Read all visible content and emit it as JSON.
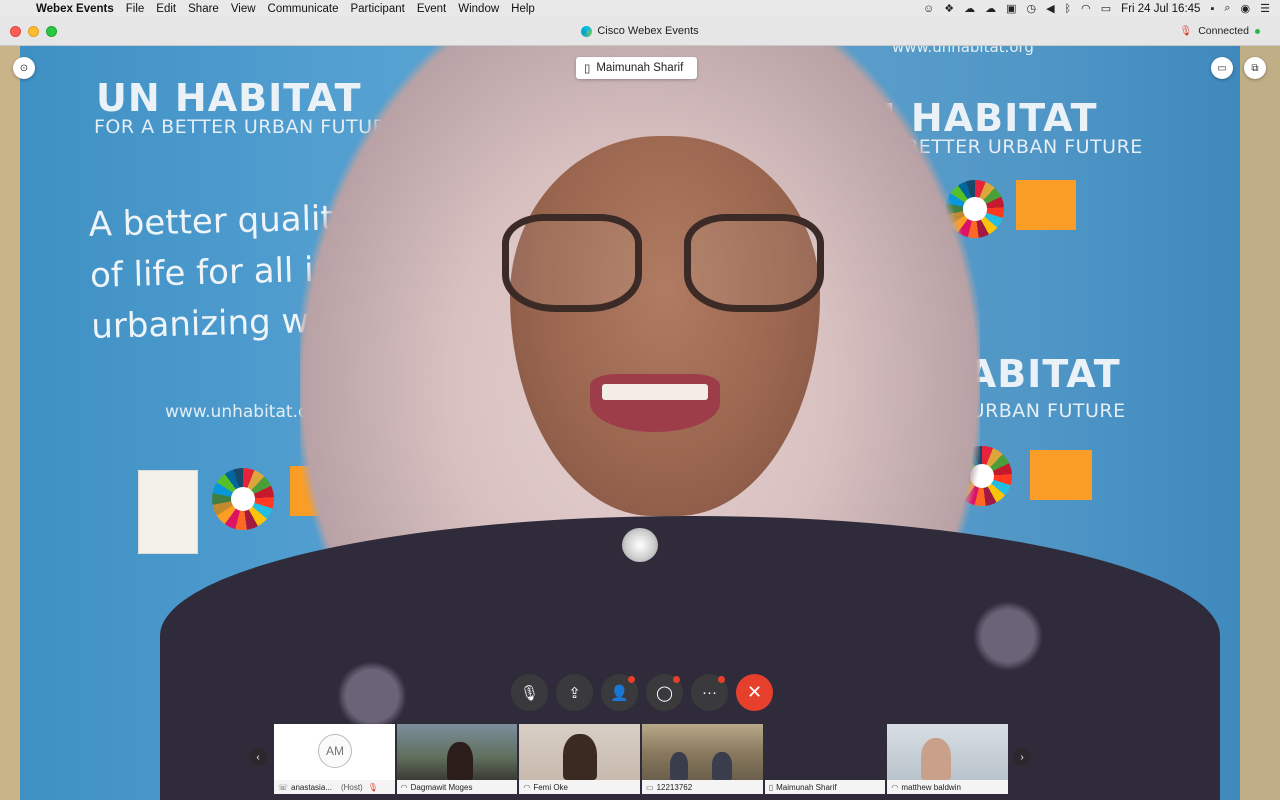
{
  "menubar": {
    "app_name": "Webex Events",
    "items": [
      "File",
      "Edit",
      "Share",
      "View",
      "Communicate",
      "Participant",
      "Event",
      "Window",
      "Help"
    ],
    "clock": "Fri 24 Jul  16:45"
  },
  "window": {
    "title": "Cisco Webex Events",
    "connection_status": "Connected"
  },
  "active_speaker": {
    "name": "Maimunah Sharif"
  },
  "background": {
    "logo_left": "UN HABITAT",
    "logo_sub": "FOR A BETTER URBAN FUTURE",
    "slogan_lines": [
      "A better quality",
      "of life for all in an",
      "urbanizing world"
    ],
    "url": "www.unhabitat.org",
    "url_top": "www.unhabitat.org",
    "logo_right_top": "UN HABITAT",
    "logo_right_sub": "FOR A BETTER URBAN FUTURE",
    "logo_right_mid": "HABITAT",
    "logo_right_mid_sub": "BETTER URBAN FUTURE"
  },
  "controls": [
    {
      "name": "mute-button",
      "icon": "mic-off-icon",
      "badge": false
    },
    {
      "name": "share-button",
      "icon": "share-icon",
      "badge": false
    },
    {
      "name": "participants-button",
      "icon": "participants-icon",
      "badge": true
    },
    {
      "name": "chat-button",
      "icon": "chat-icon",
      "badge": true
    },
    {
      "name": "more-button",
      "icon": "more-icon",
      "badge": true
    },
    {
      "name": "leave-button",
      "icon": "close-icon",
      "badge": false
    }
  ],
  "filmstrip": {
    "participants": [
      {
        "initials": "AM",
        "name": "anastasia...",
        "role": "(Host)",
        "device": "phone"
      },
      {
        "name": "Dagmawit Moges",
        "device": "headset"
      },
      {
        "name": "Femi Oke",
        "device": "headset"
      },
      {
        "name": "12213762",
        "device": "room"
      },
      {
        "name": "Maimunah Sharif",
        "device": "mobile"
      },
      {
        "name": "matthew baldwin",
        "device": "headset"
      }
    ]
  },
  "colors": {
    "end_call": "#e6402d",
    "backdrop_blue": "#4c9acd",
    "connected_dot": "#2db84d"
  }
}
